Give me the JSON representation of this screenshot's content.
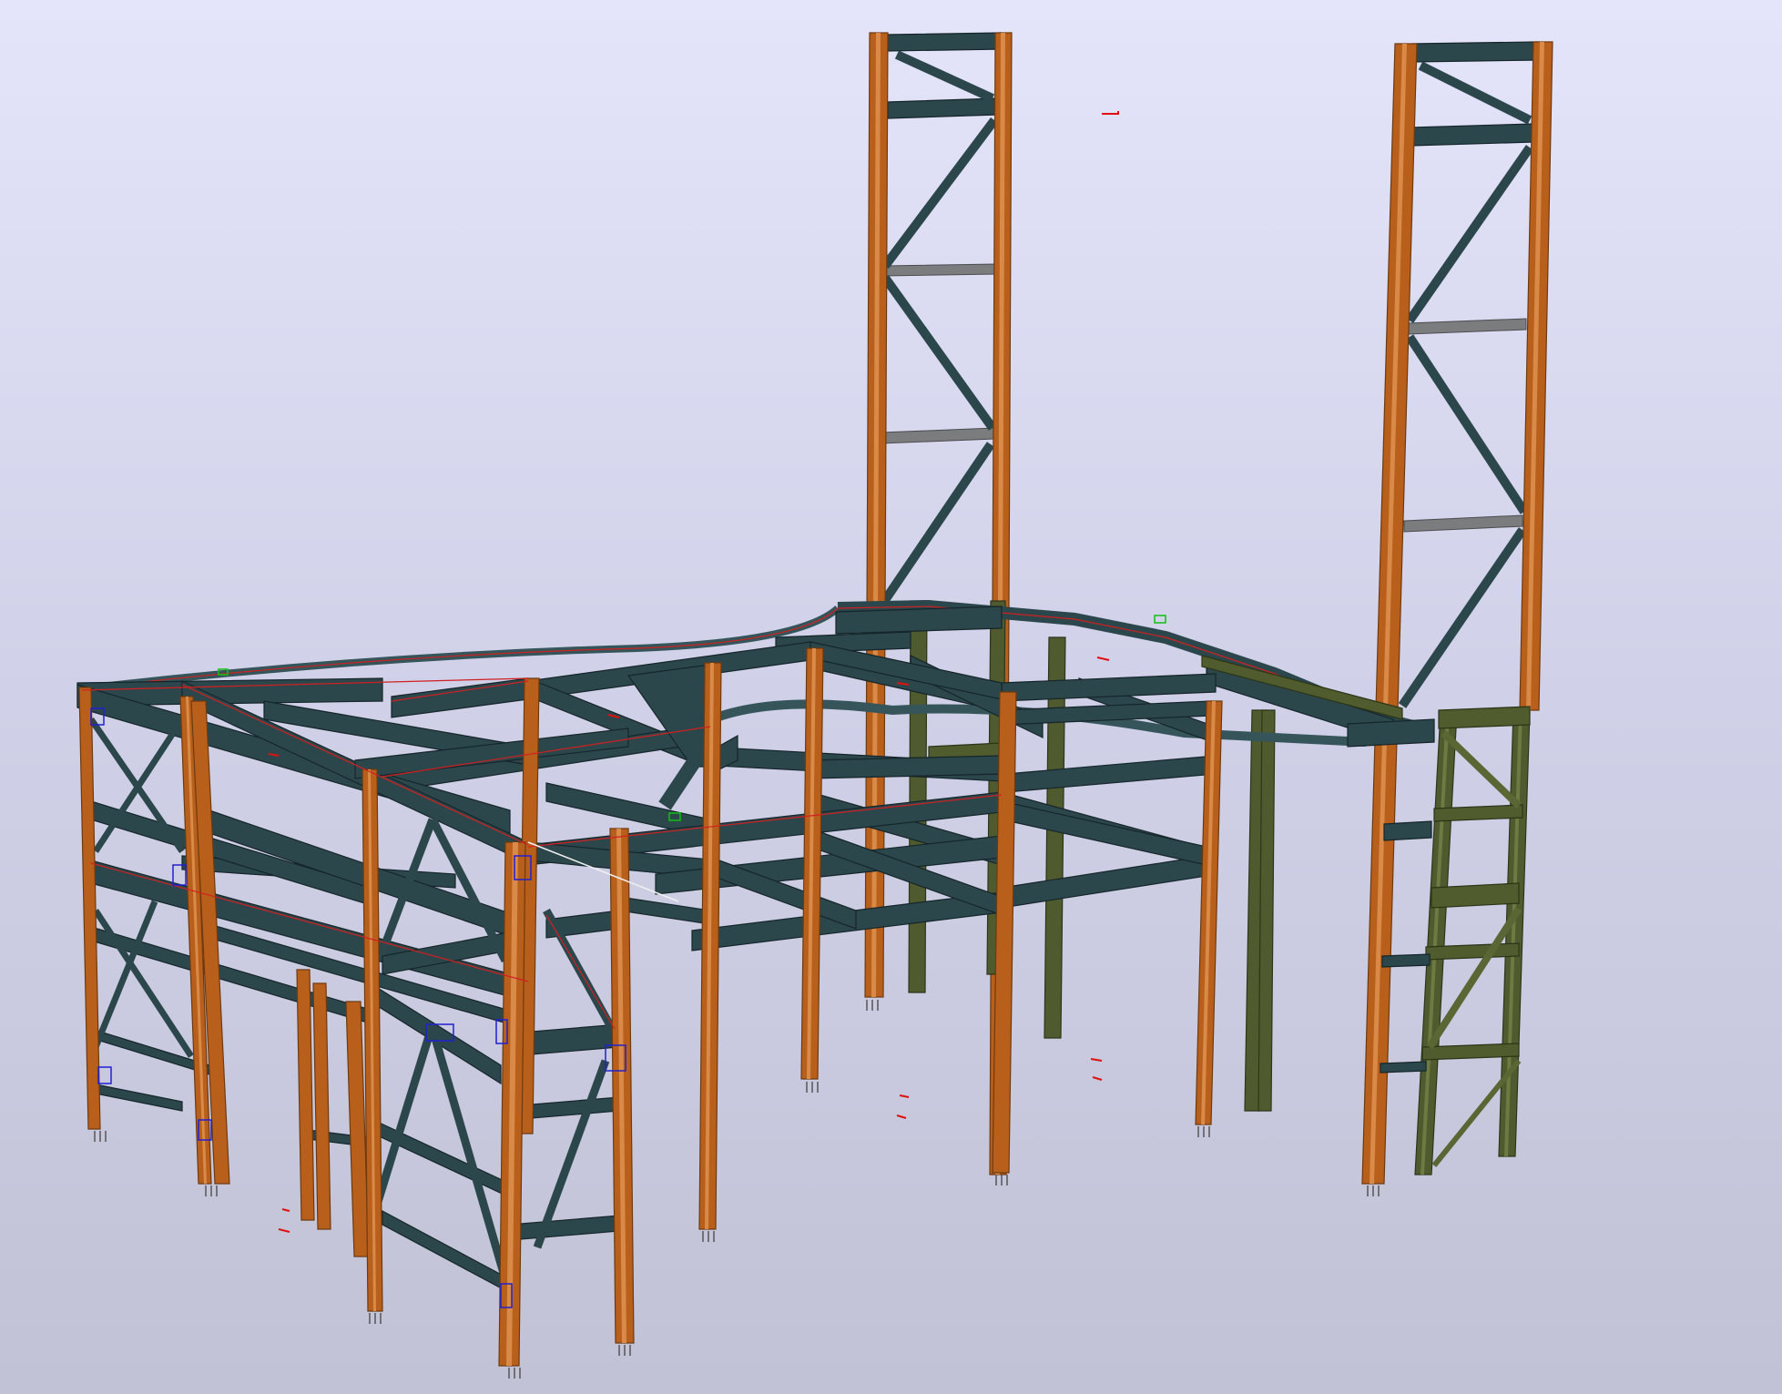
{
  "viewport": {
    "background_top": "#e4e4fa",
    "background_bottom": "#c2c2d6",
    "colors": {
      "column": "#b85f1c",
      "column_secondary": "#4f5a2e",
      "beam": "#2c474c",
      "beam_secondary": "#505c2e",
      "beam_grey": "#7a7c7e",
      "marker": "#e01010",
      "connection_box": "#2020d0"
    }
  }
}
